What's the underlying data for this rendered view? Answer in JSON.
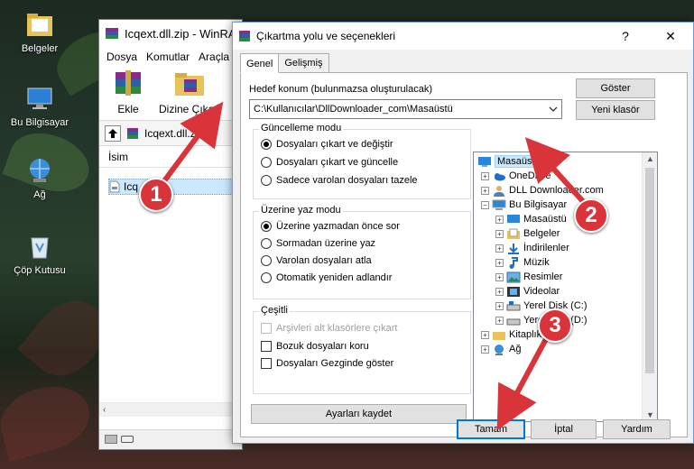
{
  "desktop": {
    "icons": [
      {
        "label": "Belgeler"
      },
      {
        "label": "Bu Bilgisayar"
      },
      {
        "label": "Ağ"
      },
      {
        "label": "Çöp Kutusu"
      }
    ]
  },
  "winrar": {
    "title": "Icqext.dll.zip - WinRA",
    "menu": [
      "Dosya",
      "Komutlar",
      "Araçla"
    ],
    "toolbar": {
      "add_label": "Ekle",
      "extract_label": "Dizine Çıkart"
    },
    "address": "Icqext.dll.zi",
    "list_header": "İsim",
    "file_name": "Icq"
  },
  "dialog": {
    "title": "Çıkartma yolu ve seçenekleri",
    "help_glyph": "?",
    "close_glyph": "✕",
    "tabs": [
      "Genel",
      "Gelişmiş"
    ],
    "destination_label": "Hedef konum (bulunmazsa oluşturulacak)",
    "destination_value": "C:\\Kullanıcılar\\DllDownloader_com\\Masaüstü",
    "show_button": "Göster",
    "new_folder_button": "Yeni klasör",
    "update_mode": {
      "title": "Güncelleme modu",
      "options": [
        "Dosyaları çıkart ve değiştir",
        "Dosyaları çıkart ve güncelle",
        "Sadece varolan dosyaları tazele"
      ],
      "selected": 0
    },
    "overwrite_mode": {
      "title": "Üzerine yaz modu",
      "options": [
        "Üzerine yazmadan önce sor",
        "Sormadan üzerine yaz",
        "Varolan dosyaları atla",
        "Otomatik yeniden adlandır"
      ],
      "selected": 0
    },
    "misc": {
      "title": "Çeşitli",
      "options": [
        "Arşivleri alt klasörlere çıkart",
        "Bozuk dosyaları koru",
        "Dosyaları Gezginde göster"
      ]
    },
    "save_settings_button": "Ayarları kaydet",
    "tree": [
      {
        "label": "Masaüstü",
        "selected": true
      },
      {
        "label": "OneDrive"
      },
      {
        "label": "DLL Downloader.com"
      },
      {
        "label": "Bu Bilgisayar"
      },
      {
        "label": "Masaüstü"
      },
      {
        "label": "Belgeler"
      },
      {
        "label": "İndirilenler"
      },
      {
        "label": "Müzik"
      },
      {
        "label": "Resimler"
      },
      {
        "label": "Videolar"
      },
      {
        "label": "Yerel Disk (C:)"
      },
      {
        "label": "Yerel Disk (D:)"
      },
      {
        "label": "Kitaplık"
      },
      {
        "label": "Ağ"
      }
    ],
    "ok_button": "Tamam",
    "cancel_button": "İptal",
    "help_button": "Yardım"
  },
  "callouts": [
    "1",
    "2",
    "3"
  ],
  "colors": {
    "accent": "#0078d7",
    "callout": "#d9343a",
    "selection": "#cce8ff"
  }
}
